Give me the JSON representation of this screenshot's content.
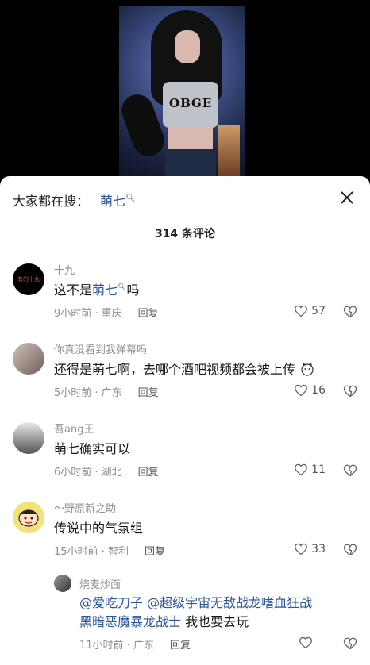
{
  "search": {
    "prefix": "大家都在搜：",
    "term": "萌七"
  },
  "comments_title": "314 条评论",
  "comments": [
    {
      "author": "十九",
      "text_before": "这不是",
      "highlight": "萌七",
      "text_after": "吗",
      "time": "9小时前 · 重庆",
      "reply": "回复",
      "likes": "57",
      "avatar_text": "有的十九"
    },
    {
      "author": "你真没看到我弹幕吗",
      "text": "还得是萌七啊，去哪个酒吧视频都会被上传",
      "time": "5小时前 · 广东",
      "reply": "回复",
      "likes": "16"
    },
    {
      "author": "吾ang王",
      "text": "萌七确实可以",
      "time": "6小时前 · 湖北",
      "reply": "回复",
      "likes": "11"
    },
    {
      "author": "～野原新之助",
      "text": "传说中的气氛组",
      "time": "15小时前 · 智利",
      "reply": "回复",
      "likes": "33"
    }
  ],
  "sub_reply": {
    "author": "烧麦炒面",
    "mention1": "@爱吃刀子",
    "mention2": "@超级宇宙无敌战龙嗜血狂战",
    "line2_mention": "黑暗恶魔暴龙战士",
    "line2_text": " 我也要去玩",
    "time": "11小时前 · 广东",
    "reply": "回复"
  },
  "video_overlay": {
    "shirt_text": "OBGE"
  }
}
